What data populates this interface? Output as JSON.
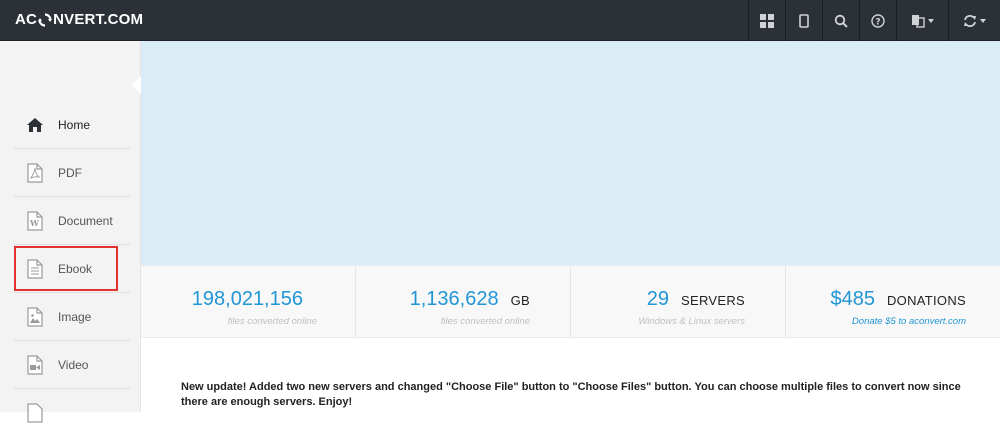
{
  "header": {
    "logo_left": "AC",
    "logo_right": "NVERT.COM",
    "buttons": [
      {
        "icon": "grid-icon"
      },
      {
        "icon": "tablet-icon"
      },
      {
        "icon": "search-icon"
      },
      {
        "icon": "help-icon"
      },
      {
        "icon": "language-icon"
      },
      {
        "icon": "refresh-icon"
      }
    ]
  },
  "sidebar": {
    "items": [
      {
        "label": "Home",
        "icon": "home-icon",
        "active": true
      },
      {
        "label": "PDF",
        "icon": "pdf-file-icon"
      },
      {
        "label": "Document",
        "icon": "word-file-icon"
      },
      {
        "label": "Ebook",
        "icon": "ebook-file-icon"
      },
      {
        "label": "Image",
        "icon": "image-file-icon"
      },
      {
        "label": "Video",
        "icon": "video-file-icon"
      }
    ]
  },
  "stats": [
    {
      "value": "198,021,156",
      "unit": "",
      "caption": "files converted online"
    },
    {
      "value": "1,136,628",
      "unit": "GB",
      "caption": "files converted online"
    },
    {
      "value": "29",
      "unit": "SERVERS",
      "caption": "Windows & Linux servers"
    },
    {
      "value": "$485",
      "unit": "DONATIONS",
      "caption": "Donate $5 to aconvert.com"
    }
  ],
  "notice": "New update! Added two new servers and changed \"Choose File\" button to \"Choose Files\" button. You can choose multiple files to convert now since there are enough servers. Enjoy!",
  "colors": {
    "topbar": "#2b3136",
    "accent": "#2196d6",
    "banner": "#daedf6",
    "highlight": "#e0322f"
  }
}
